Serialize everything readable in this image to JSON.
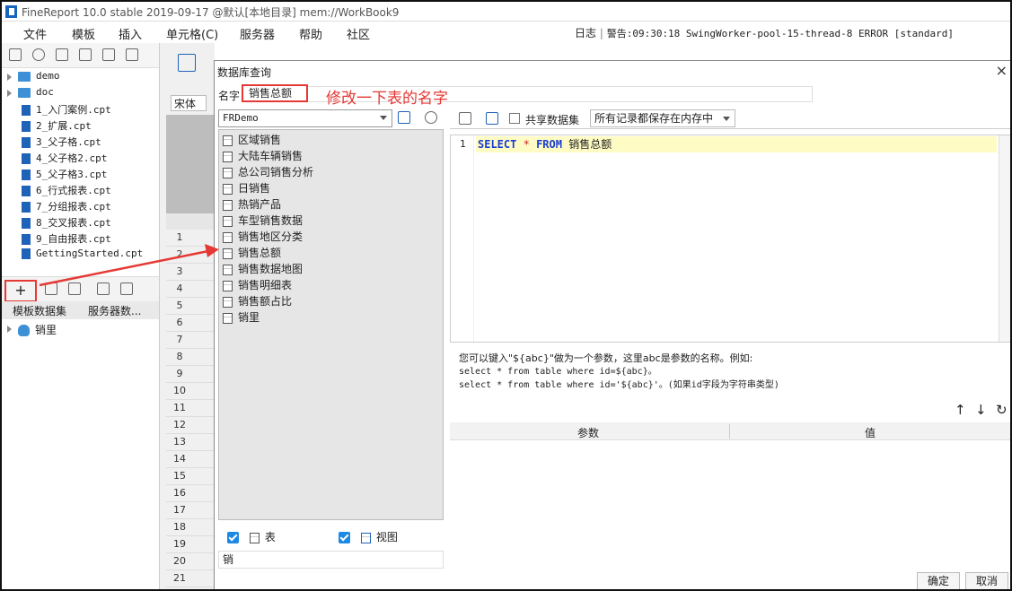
{
  "window": {
    "title": "FineReport 10.0 stable 2019-09-17 @默认[本地目录]    mem://WorkBook9"
  },
  "menu": {
    "items": [
      "文件",
      "模板",
      "插入",
      "单元格(C)",
      "服务器",
      "帮助",
      "社区"
    ],
    "status_log": "日志",
    "status_warn": "警告:09:30:18 SwingWorker-pool-15-thread-8 ERROR [standard]"
  },
  "file_tree": {
    "folders": [
      "demo",
      "doc"
    ],
    "files": [
      "1_入门案例.cpt",
      "2_扩展.cpt",
      "3_父子格.cpt",
      "4_父子格2.cpt",
      "5_父子格3.cpt",
      "6_行式报表.cpt",
      "7_分组报表.cpt",
      "8_交叉报表.cpt",
      "9_自由报表.cpt",
      "GettingStarted.cpt"
    ]
  },
  "dataset_panel": {
    "plus_label": "+",
    "tabs": [
      "模板数据集",
      "服务器数..."
    ],
    "items": [
      "销里"
    ]
  },
  "sheet": {
    "font": "宋体",
    "rows": [
      "1",
      "2",
      "3",
      "4",
      "5",
      "6",
      "7",
      "8",
      "9",
      "10",
      "11",
      "12",
      "13",
      "14",
      "15",
      "16",
      "17",
      "18",
      "19",
      "20",
      "21"
    ]
  },
  "dialog": {
    "title": "数据库查询",
    "close": "×",
    "name_label": "名字",
    "name_value": "销售总额",
    "annotation": "修改一下表的名字",
    "connection": "FRDemo",
    "tables": [
      "区域销售",
      "大陆车辆销售",
      "总公司销售分析",
      "日销售",
      "热销产品",
      "车型销售数据",
      "销售地区分类",
      "销售总额",
      "销售数据地图",
      "销售明细表",
      "销售额占比",
      "销里"
    ],
    "show_tables_label": "表",
    "show_views_label": "视图",
    "filter_value": "销",
    "share_label": "共享数据集",
    "memory_option": "所有记录都保存在内存中",
    "sql_line_number": "1",
    "sql_select": "SELECT",
    "sql_star": "*",
    "sql_from": "FROM",
    "sql_table": "销售总额",
    "hint_line1": "您可以键入\"${abc}\"做为一个参数，这里abc是参数的名称。例如:",
    "hint_line2": "select * from table where id=${abc}。",
    "hint_line3": "select * from table where id='${abc}'。(如果id字段为字符串类型)",
    "param_col": "参数",
    "value_col": "值",
    "ok_label": "确定",
    "cancel_label": "取消"
  },
  "colors": {
    "accent_red": "#e53935",
    "checkbox_blue": "#1e88e5",
    "sql_highlight": "#fffbc4"
  }
}
